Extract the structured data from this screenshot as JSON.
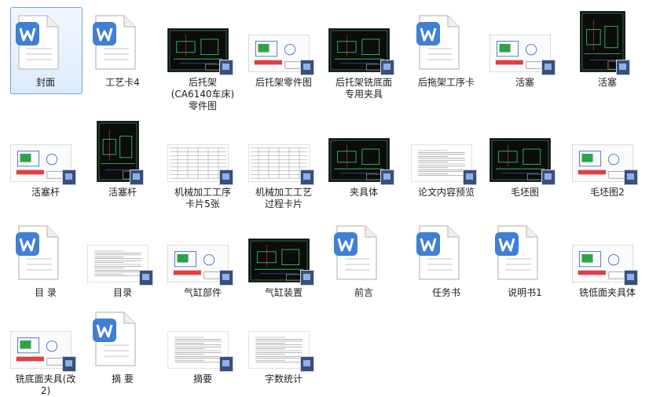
{
  "files": [
    {
      "name": "封面",
      "type": "word"
    },
    {
      "name": "工艺卡4",
      "type": "word"
    },
    {
      "name": "后托架\n(CA6140车床)\n零件图",
      "type": "cad-dark"
    },
    {
      "name": "后托架零件图",
      "type": "cad-light"
    },
    {
      "name": "后托架铣底面\n专用夹具",
      "type": "cad-dark"
    },
    {
      "name": "后拖架工序卡",
      "type": "word"
    },
    {
      "name": "活塞",
      "type": "cad-light"
    },
    {
      "name": "活塞",
      "type": "cad-dark"
    },
    {
      "name": "活塞杆",
      "type": "cad-light"
    },
    {
      "name": "活塞杆",
      "type": "cad-dark"
    },
    {
      "name": "机械加工工序\n卡片5张",
      "type": "sheet"
    },
    {
      "name": "机械加工工艺\n过程卡片",
      "type": "sheet"
    },
    {
      "name": "夹具体",
      "type": "cad-dark"
    },
    {
      "name": "论文内容预览",
      "type": "text"
    },
    {
      "name": "毛坯图",
      "type": "cad-dark"
    },
    {
      "name": "毛坯图2",
      "type": "cad-light"
    },
    {
      "name": "目    录",
      "type": "word"
    },
    {
      "name": "目录",
      "type": "text"
    },
    {
      "name": "气缸部件",
      "type": "cad-light"
    },
    {
      "name": "气缸装置",
      "type": "cad-dark"
    },
    {
      "name": "前言",
      "type": "word"
    },
    {
      "name": "任务书",
      "type": "word"
    },
    {
      "name": "说明书1",
      "type": "word"
    },
    {
      "name": "铣低面夹具体",
      "type": "cad-light"
    },
    {
      "name": "铣底面夹具(改\n2)",
      "type": "cad-light"
    },
    {
      "name": "摘    要",
      "type": "word"
    },
    {
      "name": "摘要",
      "type": "text"
    },
    {
      "name": "字数统计",
      "type": "text"
    }
  ],
  "colors": {
    "selection_border": "#7da2ce",
    "word_blue": "#3f7fd4",
    "cad_bg": "#0c0c0c"
  },
  "icons": [
    "word-document-icon",
    "cad-drawing-thumbnail",
    "image-file-badge-icon"
  ]
}
